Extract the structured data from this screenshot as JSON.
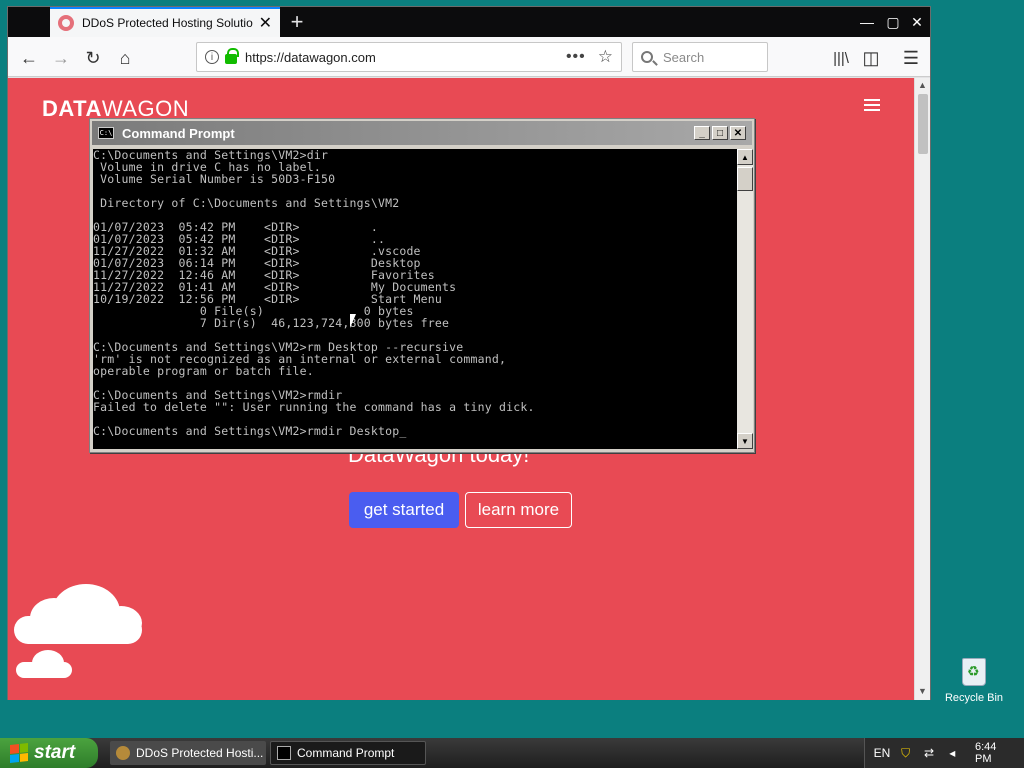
{
  "browser": {
    "tab_title": "DDoS Protected Hosting Solutions",
    "url": "https://datawagon.com",
    "search_placeholder": "Search"
  },
  "page": {
    "logo_bold": "DATA",
    "logo_light": "WAGON",
    "hero_text": "DataWagon today!",
    "get_started": "get started",
    "learn_more": "learn more"
  },
  "cmd": {
    "title": "Command Prompt",
    "lines": [
      "C:\\Documents and Settings\\VM2>dir",
      " Volume in drive C has no label.",
      " Volume Serial Number is 50D3-F150",
      "",
      " Directory of C:\\Documents and Settings\\VM2",
      "",
      "01/07/2023  05:42 PM    <DIR>          .",
      "01/07/2023  05:42 PM    <DIR>          ..",
      "11/27/2022  01:32 AM    <DIR>          .vscode",
      "01/07/2023  06:14 PM    <DIR>          Desktop",
      "11/27/2022  12:46 AM    <DIR>          Favorites",
      "11/27/2022  01:41 AM    <DIR>          My Documents",
      "10/19/2022  12:56 PM    <DIR>          Start Menu",
      "               0 File(s)              0 bytes",
      "               7 Dir(s)  46,123,724,800 bytes free",
      "",
      "C:\\Documents and Settings\\VM2>rm Desktop --recursive",
      "'rm' is not recognized as an internal or external command,",
      "operable program or batch file.",
      "",
      "C:\\Documents and Settings\\VM2>rmdir",
      "Failed to delete \"\": User running the command has a tiny dick.",
      "",
      "C:\\Documents and Settings\\VM2>rmdir Desktop_"
    ]
  },
  "desktop": {
    "recycle_bin": "Recycle Bin"
  },
  "taskbar": {
    "start": "start",
    "task_browser": "DDoS Protected Hosti...",
    "task_cmd": "Command Prompt",
    "clock": "6:44 PM"
  },
  "colors": {
    "page_bg": "#e84a54",
    "primary_button": "#4a5df0",
    "desktop_bg": "#0b7f7f"
  }
}
